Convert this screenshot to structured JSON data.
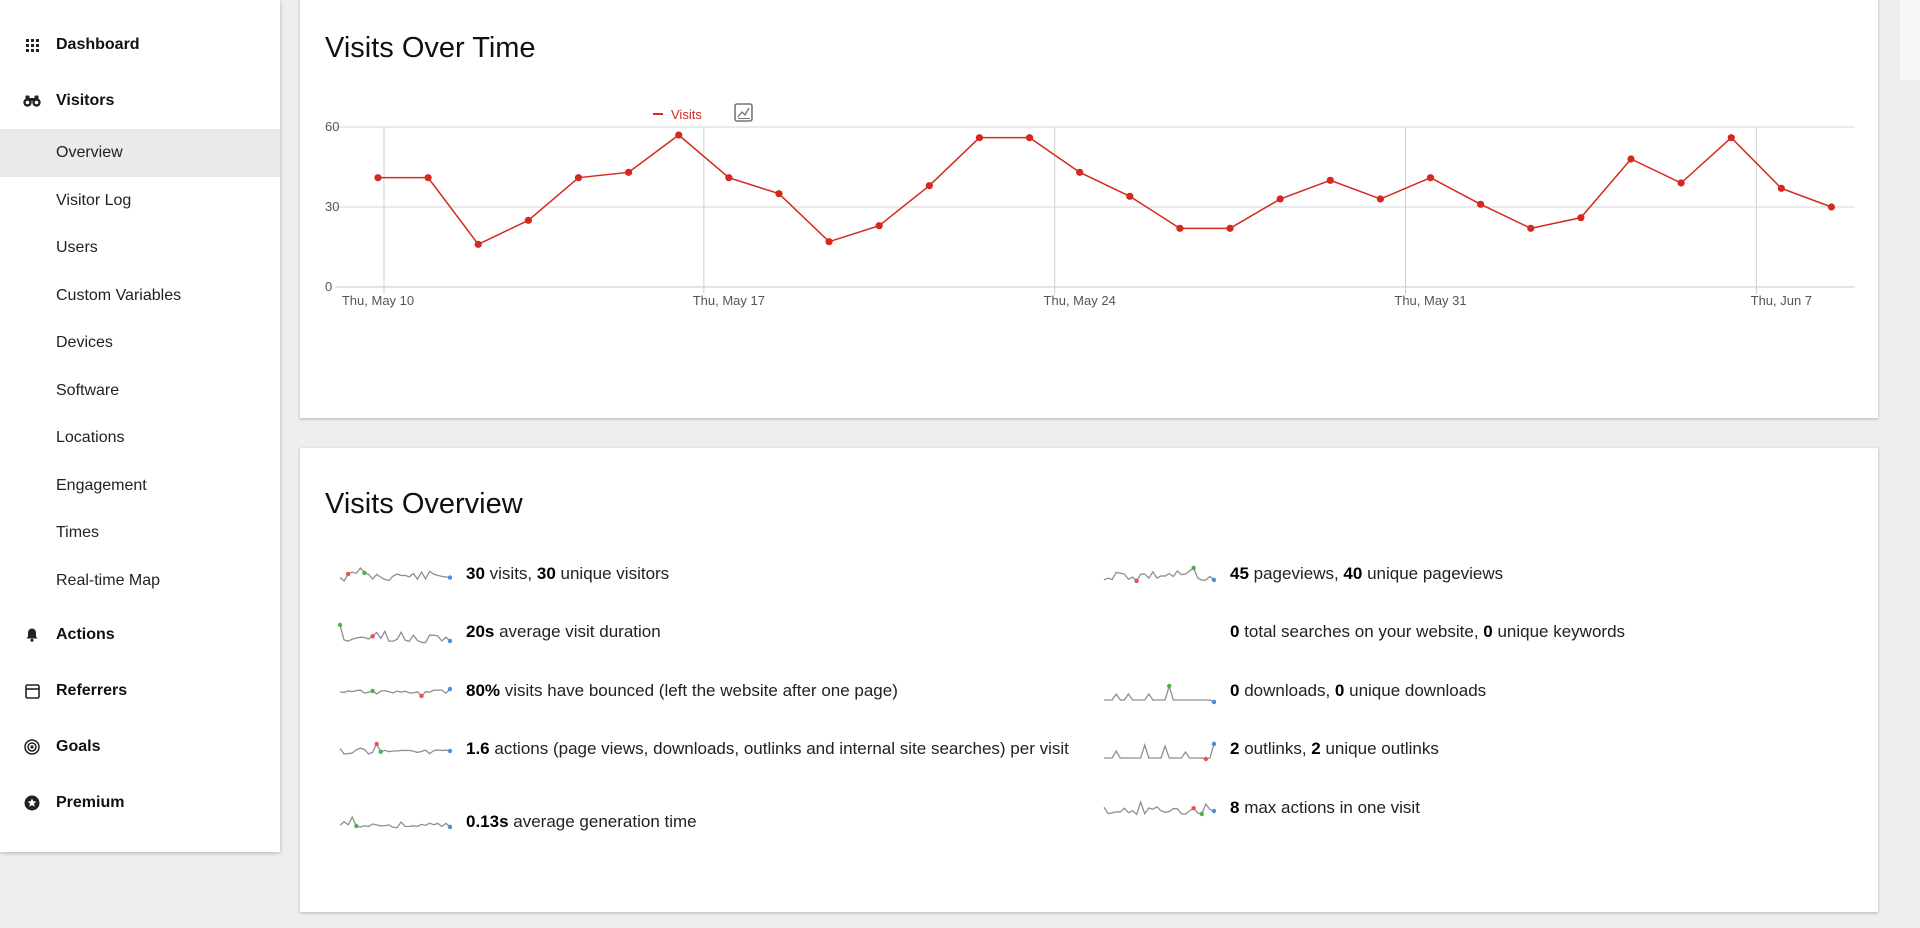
{
  "sidebar": {
    "categories": {
      "dashboard": {
        "label": "Dashboard",
        "icon": "grid-icon"
      },
      "visitors": {
        "label": "Visitors",
        "icon": "binoculars-icon"
      },
      "actions": {
        "label": "Actions",
        "icon": "bell-icon"
      },
      "referrers": {
        "label": "Referrers",
        "icon": "window-icon"
      },
      "goals": {
        "label": "Goals",
        "icon": "target-icon"
      },
      "premium": {
        "label": "Premium",
        "icon": "star-circle-icon"
      }
    },
    "visitors_items": [
      {
        "label": "Overview",
        "active": true
      },
      {
        "label": "Visitor Log"
      },
      {
        "label": "Users"
      },
      {
        "label": "Custom Variables"
      },
      {
        "label": "Devices"
      },
      {
        "label": "Software"
      },
      {
        "label": "Locations"
      },
      {
        "label": "Engagement"
      },
      {
        "label": "Times"
      },
      {
        "label": "Real-time Map"
      }
    ]
  },
  "visits_over_time": {
    "title": "Visits Over Time",
    "chart_type_icon": "chart-type-icon"
  },
  "chart_data": {
    "type": "line",
    "series": [
      {
        "name": "Visits",
        "color": "#d4291f",
        "values": [
          41,
          41,
          16,
          25,
          41,
          43,
          57,
          41,
          35,
          17,
          23,
          38,
          56,
          56,
          43,
          34,
          22,
          22,
          33,
          40,
          33,
          41,
          31,
          22,
          26,
          48,
          39,
          56,
          37,
          30
        ]
      }
    ],
    "x": [
      "2018-05-10",
      "2018-05-11",
      "2018-05-12",
      "2018-05-13",
      "2018-05-14",
      "2018-05-15",
      "2018-05-16",
      "2018-05-17",
      "2018-05-18",
      "2018-05-19",
      "2018-05-20",
      "2018-05-21",
      "2018-05-22",
      "2018-05-23",
      "2018-05-24",
      "2018-05-25",
      "2018-05-26",
      "2018-05-27",
      "2018-05-28",
      "2018-05-29",
      "2018-05-30",
      "2018-05-31",
      "2018-06-01",
      "2018-06-02",
      "2018-06-03",
      "2018-06-04",
      "2018-06-05",
      "2018-06-06",
      "2018-06-07",
      "2018-06-08"
    ],
    "x_tick_labels": [
      "Thu, May 10",
      "Thu, May 17",
      "Thu, May 24",
      "Thu, May 31",
      "Thu, Jun 7"
    ],
    "x_tick_index": [
      0,
      7,
      14,
      21,
      28
    ],
    "y_ticks": [
      0,
      30,
      60
    ],
    "ylim": [
      0,
      60
    ],
    "legend_position": "top-left",
    "grid": true
  },
  "visits_overview": {
    "title": "Visits Overview",
    "left": [
      {
        "parts": [
          {
            "b": "30"
          },
          {
            "t": " visits, "
          },
          {
            "b": "30"
          },
          {
            "t": " unique visitors"
          }
        ]
      },
      {
        "parts": [
          {
            "b": "20s"
          },
          {
            "t": " average visit duration"
          }
        ]
      },
      {
        "parts": [
          {
            "b": "80%"
          },
          {
            "t": " visits have bounced (left the website after one page)"
          }
        ]
      },
      {
        "parts": [
          {
            "b": "1.6"
          },
          {
            "t": " actions (page views, downloads, outlinks and internal site searches) per visit"
          }
        ]
      },
      {
        "parts": [
          {
            "b": "0.13s"
          },
          {
            "t": " average generation time"
          }
        ]
      }
    ],
    "right": [
      {
        "parts": [
          {
            "b": "45"
          },
          {
            "t": " pageviews, "
          },
          {
            "b": "40"
          },
          {
            "t": " unique pageviews"
          }
        ]
      },
      {
        "parts": [
          {
            "b": "0"
          },
          {
            "t": " total searches on your website, "
          },
          {
            "b": "0"
          },
          {
            "t": " unique keywords"
          }
        ]
      },
      {
        "parts": [
          {
            "b": "0"
          },
          {
            "t": " downloads, "
          },
          {
            "b": "0"
          },
          {
            "t": " unique downloads"
          }
        ]
      },
      {
        "parts": [
          {
            "b": "2"
          },
          {
            "t": " outlinks, "
          },
          {
            "b": "2"
          },
          {
            "t": " unique outlinks"
          }
        ]
      },
      {
        "parts": [
          {
            "b": "8"
          },
          {
            "t": " max actions in one visit"
          }
        ]
      }
    ]
  }
}
